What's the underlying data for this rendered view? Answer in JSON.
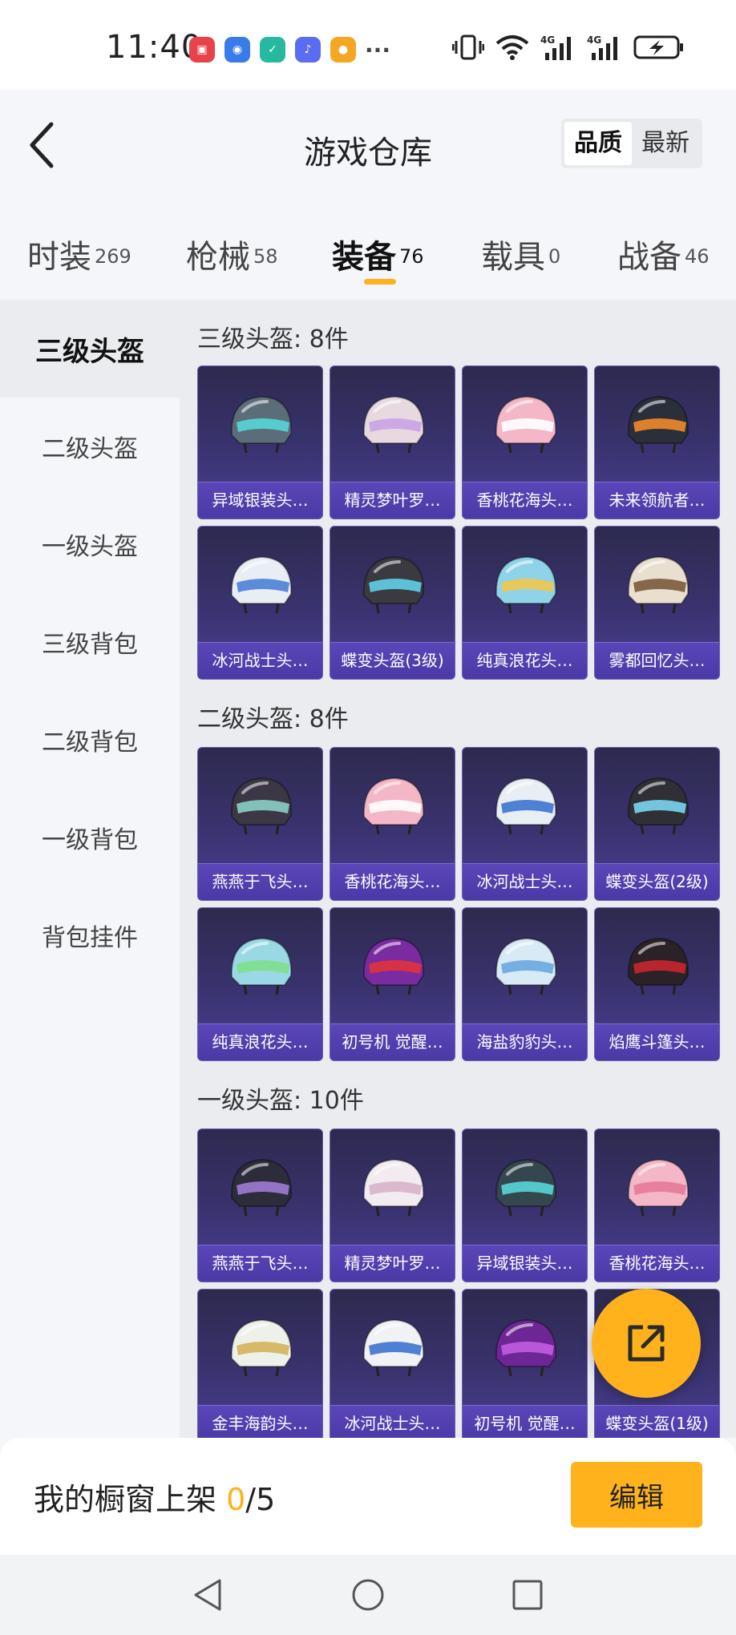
{
  "status_bar": {
    "time": "11:40",
    "notifications": [
      {
        "icon": "huawei-app-icon",
        "color": "#e8424a",
        "glyph": "▣"
      },
      {
        "icon": "browser-icon",
        "color": "#3a7bea",
        "glyph": "◉"
      },
      {
        "icon": "security-shield-icon",
        "color": "#27b9a0",
        "glyph": "✓"
      },
      {
        "icon": "music-icon",
        "color": "#5a6cf0",
        "glyph": "♪"
      },
      {
        "icon": "game-app-icon",
        "color": "#f5a623",
        "glyph": "●"
      }
    ],
    "more": "···",
    "network_labels": [
      "4G",
      "4G"
    ]
  },
  "header": {
    "title": "游戏仓库",
    "sort_options": [
      {
        "label": "品质",
        "active": true
      },
      {
        "label": "最新",
        "active": false
      }
    ]
  },
  "tabs": [
    {
      "label": "时装",
      "count": "269",
      "active": false
    },
    {
      "label": "枪械",
      "count": "58",
      "active": false
    },
    {
      "label": "装备",
      "count": "76",
      "active": true
    },
    {
      "label": "载具",
      "count": "0",
      "active": false
    },
    {
      "label": "战备",
      "count": "46",
      "active": false
    }
  ],
  "sidebar": [
    {
      "label": "三级头盔",
      "active": true
    },
    {
      "label": "二级头盔",
      "active": false
    },
    {
      "label": "一级头盔",
      "active": false
    },
    {
      "label": "三级背包",
      "active": false
    },
    {
      "label": "二级背包",
      "active": false
    },
    {
      "label": "一级背包",
      "active": false
    },
    {
      "label": "背包挂件",
      "active": false
    }
  ],
  "sections": [
    {
      "title": "三级头盔: 8件",
      "items": [
        {
          "name": "异域银装头…",
          "color": "#5c6d7a",
          "accent": "#55d6d8"
        },
        {
          "name": "精灵梦叶罗…",
          "color": "#e8d8e0",
          "accent": "#c9a4e6"
        },
        {
          "name": "香桃花海头…",
          "color": "#f3b7c7",
          "accent": "#ffffff"
        },
        {
          "name": "未来领航者…",
          "color": "#2b2f3a",
          "accent": "#f08a2a"
        },
        {
          "name": "冰河战士头…",
          "color": "#e9eef5",
          "accent": "#4c7fd6"
        },
        {
          "name": "蝶变头盔(3级)",
          "color": "#3a3a40",
          "accent": "#5fd0e8"
        },
        {
          "name": "纯真浪花头…",
          "color": "#8fd3e8",
          "accent": "#f0c84a"
        },
        {
          "name": "雾都回忆头…",
          "color": "#e8dfcf",
          "accent": "#7a5a3a"
        }
      ]
    },
    {
      "title": "二级头盔: 8件",
      "items": [
        {
          "name": "燕燕于飞头…",
          "color": "#3b3744",
          "accent": "#8ad0c8"
        },
        {
          "name": "香桃花海头…",
          "color": "#f3b7c7",
          "accent": "#ffffff"
        },
        {
          "name": "冰河战士头…",
          "color": "#e9eef5",
          "accent": "#3d73d0"
        },
        {
          "name": "蝶变头盔(2级)",
          "color": "#2f2f35",
          "accent": "#79d6ee"
        },
        {
          "name": "纯真浪花头…",
          "color": "#9ad8e6",
          "accent": "#7ee08a"
        },
        {
          "name": "初号机 觉醒…",
          "color": "#7a2ba0",
          "accent": "#e0333a"
        },
        {
          "name": "海盐豹豹头…",
          "color": "#d8eaf5",
          "accent": "#6aa8e0"
        },
        {
          "name": "焰鹰斗篷头…",
          "color": "#2a2226",
          "accent": "#c8262f"
        }
      ]
    },
    {
      "title": "一级头盔: 10件",
      "items": [
        {
          "name": "燕燕于飞头…",
          "color": "#2c2c3a",
          "accent": "#a07ad6"
        },
        {
          "name": "精灵梦叶罗…",
          "color": "#f2ebef",
          "accent": "#d8b4c8"
        },
        {
          "name": "异域银装头…",
          "color": "#34464e",
          "accent": "#55d6d8"
        },
        {
          "name": "香桃花海头…",
          "color": "#f3b7c7",
          "accent": "#e67a9a"
        },
        {
          "name": "金丰海韵头…",
          "color": "#eef0ea",
          "accent": "#d4b45a"
        },
        {
          "name": "冰河战士头…",
          "color": "#f0f2f6",
          "accent": "#3d73d0"
        },
        {
          "name": "初号机 觉醒…",
          "color": "#6e2696",
          "accent": "#c25de0"
        },
        {
          "name": "蝶变头盔(1级)",
          "color": "#2f2f35",
          "accent": "#79d6ee"
        }
      ]
    }
  ],
  "bottom_bar": {
    "label_prefix": "我的橱窗上架 ",
    "count": "0",
    "total": "/5",
    "edit_label": "编辑"
  },
  "colors": {
    "accent": "#ffb21c",
    "card_bg": "#3a3370",
    "card_strip": "#5a46b8"
  }
}
